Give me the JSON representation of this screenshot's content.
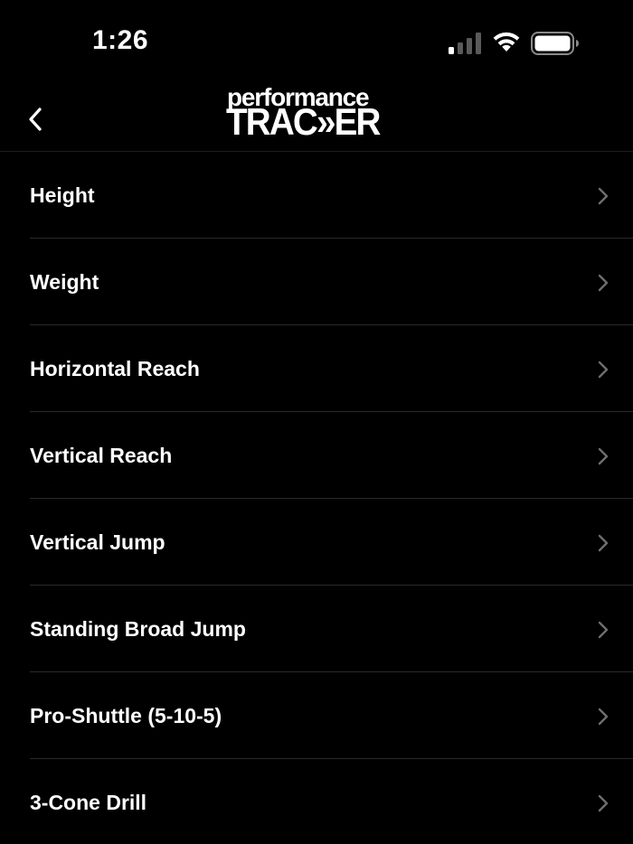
{
  "status_bar": {
    "time": "1:26",
    "signal_icon": "cellular-signal-icon",
    "wifi_icon": "wifi-icon",
    "battery_icon": "battery-icon"
  },
  "nav": {
    "back_icon": "chevron-left-icon",
    "logo_top": "performance",
    "logo_bottom": "TRAC»ER"
  },
  "list": {
    "items": [
      {
        "label": "Height"
      },
      {
        "label": "Weight"
      },
      {
        "label": "Horizontal Reach"
      },
      {
        "label": "Vertical Reach"
      },
      {
        "label": "Vertical Jump"
      },
      {
        "label": "Standing Broad Jump"
      },
      {
        "label": "Pro-Shuttle (5-10-5)"
      },
      {
        "label": "3-Cone Drill"
      }
    ],
    "chevron_icon": "chevron-right-icon"
  },
  "colors": {
    "background": "#000000",
    "text": "#ffffff",
    "separator": "#2a2a2a",
    "chevron": "#6e6e6e"
  }
}
